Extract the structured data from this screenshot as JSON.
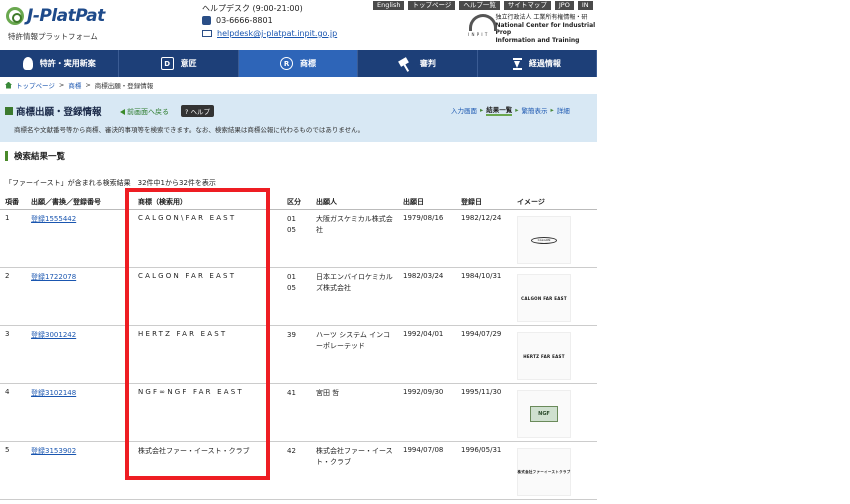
{
  "header": {
    "logo_text": "J-PlatPat",
    "logo_sub": "特許情報プラットフォーム",
    "helpdesk": "ヘルプデスク (9:00-21:00)",
    "phone": "03-6666-8801",
    "email": "helpdesk@j-platpat.inpit.go.jp",
    "top_links": [
      "English",
      "トップページ",
      "ヘルプ一覧",
      "サイトマップ",
      "JPO",
      "IN"
    ],
    "org_jp": "独立行政法人 工業所有権情報・研",
    "org_en1": "National Center for Industrial Prop",
    "org_en2": "Information and Training"
  },
  "nav": {
    "items": [
      "特許・実用新案",
      "意匠",
      "商標",
      "審判",
      "経過情報"
    ],
    "active_index": 2
  },
  "breadcrumb": [
    "トップページ",
    "商標",
    "商標出願・登録情報"
  ],
  "band": {
    "title": "商標出願・登録情報",
    "back_link": "前画面へ戻る",
    "help": "? ヘルプ",
    "steps": [
      "入力画面",
      "結果一覧",
      "繁簡表示",
      "詳細"
    ],
    "current_step": 1,
    "description": "商標名や文献番号等から商標、審決的事項等を検索できます。なお、検索結果は商標公報に代わるものではありません。"
  },
  "section_title": "検索結果一覧",
  "result_text": "「ファーイースト」が含まれる検索結果　32件中1から32件を表示",
  "table": {
    "headers": [
      "項番",
      "出願／書換／登録番号",
      "商標（検索用）",
      "区分",
      "出願人",
      "出願日",
      "登録日",
      "イメージ"
    ],
    "rows": [
      {
        "no": "1",
        "num": "登録1555442",
        "mark": "CALGON\\FAR EAST",
        "cls": "01\n05",
        "applicant": "大阪ガスケミカル株式会社",
        "filed": "1979/08/16",
        "registered": "1982/12/24",
        "image": "CALGON"
      },
      {
        "no": "2",
        "num": "登録1722078",
        "mark": "CALGON FAR EAST",
        "cls": "01\n05",
        "applicant": "日本エンバイロケミカルズ株式会社",
        "filed": "1982/03/24",
        "registered": "1984/10/31",
        "image": "CALGON FAR EAST"
      },
      {
        "no": "3",
        "num": "登録3001242",
        "mark": "HERTZ FAR EAST",
        "cls": "39",
        "applicant": "ハーツ システム インコーポレーテッド",
        "filed": "1992/04/01",
        "registered": "1994/07/29",
        "image": "HERTZ FAR EAST"
      },
      {
        "no": "4",
        "num": "登録3102148",
        "mark": "NGF∞NGF FAR EAST",
        "cls": "41",
        "applicant": "宮田 哲",
        "filed": "1992/09/30",
        "registered": "1995/11/30",
        "image": "NGF"
      },
      {
        "no": "5",
        "num": "登録3153902",
        "mark": "株式会社ファー・イースト・クラブ",
        "cls": "42",
        "applicant": "株式会社ファー・イースト・クラブ",
        "filed": "1994/07/08",
        "registered": "1996/05/31",
        "image": "株式会社ファーイーストクラブ"
      }
    ]
  },
  "colors": {
    "nav": "#1d3f78",
    "band": "#d8e8f4",
    "highlight": "#ee1d23",
    "link": "#1a56b0"
  }
}
